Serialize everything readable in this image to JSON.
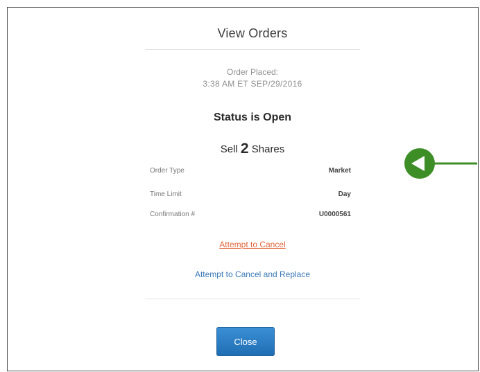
{
  "dialog": {
    "title": "View Orders",
    "order_placed_label": "Order Placed:",
    "order_placed_time": "3:38 AM ET SEP/29/2016",
    "status": "Status is Open",
    "action": "Sell",
    "quantity": "2",
    "unit": "Shares",
    "details": [
      {
        "label": "Order Type",
        "value": "Market"
      },
      {
        "label": "Time Limit",
        "value": "Day"
      },
      {
        "label": "Confirmation #",
        "value": "U0000561"
      }
    ],
    "cancel_link": "Attempt to Cancel",
    "replace_link": "Attempt to Cancel and Replace",
    "close_label": "Close"
  },
  "colors": {
    "link_orange": "#e0663a",
    "link_blue": "#3b79b7",
    "button_blue": "#1f6eb4",
    "pointer_green": "#3e8e27"
  },
  "icons": {
    "pointer": "left-arrow-callout-icon"
  }
}
